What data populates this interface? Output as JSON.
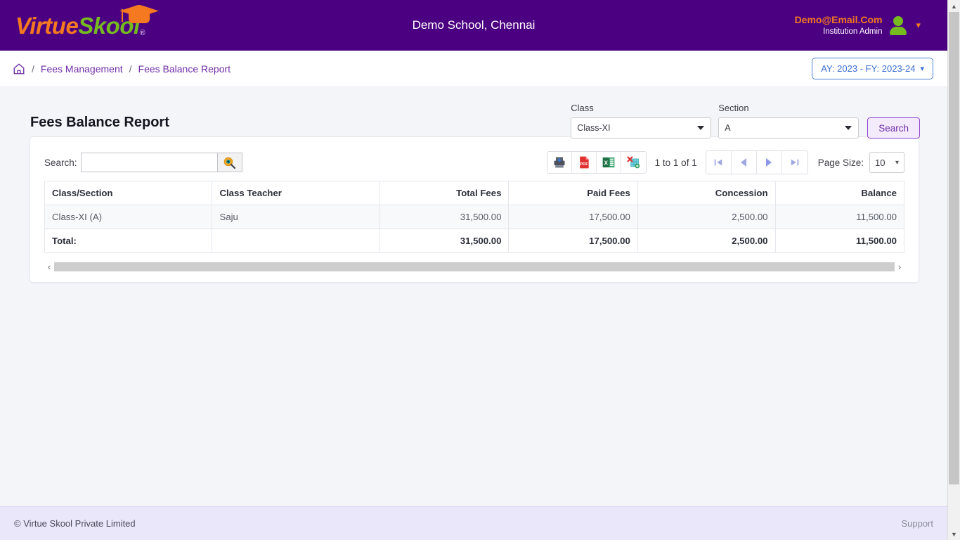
{
  "header": {
    "logo_virtue": "Virtue",
    "logo_skool": "Skool",
    "logo_reg": "®",
    "school_title": "Demo School, Chennai",
    "user_email": "Demo@Email.Com",
    "user_role": "Institution Admin"
  },
  "breadcrumb": {
    "home_icon": "home-icon",
    "sep": "/",
    "items": [
      {
        "label": "Fees Management"
      },
      {
        "label": "Fees Balance Report"
      }
    ],
    "ayfy_label": "AY: 2023 - FY: 2023-24",
    "ayfy_caret": "⌄"
  },
  "page": {
    "title": "Fees Balance Report"
  },
  "filters": {
    "class_label": "Class",
    "class_value": "Class-XI",
    "section_label": "Section",
    "section_value": "A",
    "search_button": "Search"
  },
  "toolbar": {
    "search_label": "Search:",
    "search_value": "",
    "search_placeholder": "",
    "search_icon": "magnifier-icon",
    "export": [
      {
        "name": "print-icon",
        "title": "Print"
      },
      {
        "name": "pdf-icon",
        "title": "PDF"
      },
      {
        "name": "excel-icon",
        "title": "Excel"
      },
      {
        "name": "xml-icon",
        "title": "XML"
      }
    ],
    "record_count": "1 to 1 of 1",
    "pagination": [
      {
        "name": "first-page-button",
        "glyph": "⏮"
      },
      {
        "name": "prev-page-button",
        "glyph": "◀"
      },
      {
        "name": "next-page-button",
        "glyph": "▶"
      },
      {
        "name": "last-page-button",
        "glyph": "⏭"
      }
    ],
    "page_size_label": "Page Size:",
    "page_size_value": "10",
    "page_size_caret": "⌄"
  },
  "table": {
    "columns": [
      {
        "label": "Class/Section",
        "align": "left"
      },
      {
        "label": "Class Teacher",
        "align": "left"
      },
      {
        "label": "Total Fees",
        "align": "right"
      },
      {
        "label": "Paid Fees",
        "align": "right"
      },
      {
        "label": "Concession",
        "align": "right"
      },
      {
        "label": "Balance",
        "align": "right"
      }
    ],
    "rows": [
      {
        "class_section": "Class-XI (A)",
        "class_teacher": "Saju",
        "total_fees": "31,500.00",
        "paid_fees": "17,500.00",
        "concession": "2,500.00",
        "balance": "11,500.00"
      }
    ],
    "total_row": {
      "label": "Total:",
      "blank": "",
      "total_fees": "31,500.00",
      "paid_fees": "17,500.00",
      "concession": "2,500.00",
      "balance": "11,500.00"
    },
    "hscroll_left": "‹",
    "hscroll_right": "›"
  },
  "footer": {
    "copyright": "© Virtue Skool Private Limited",
    "support": "Support"
  },
  "colors": {
    "header_purple": "#4b0082",
    "logo_orange": "#f47920",
    "logo_green": "#76bc21",
    "link_purple": "#6f2da8",
    "accent_blue": "#3a6fd0",
    "footer_lavender": "#eae7fb"
  }
}
